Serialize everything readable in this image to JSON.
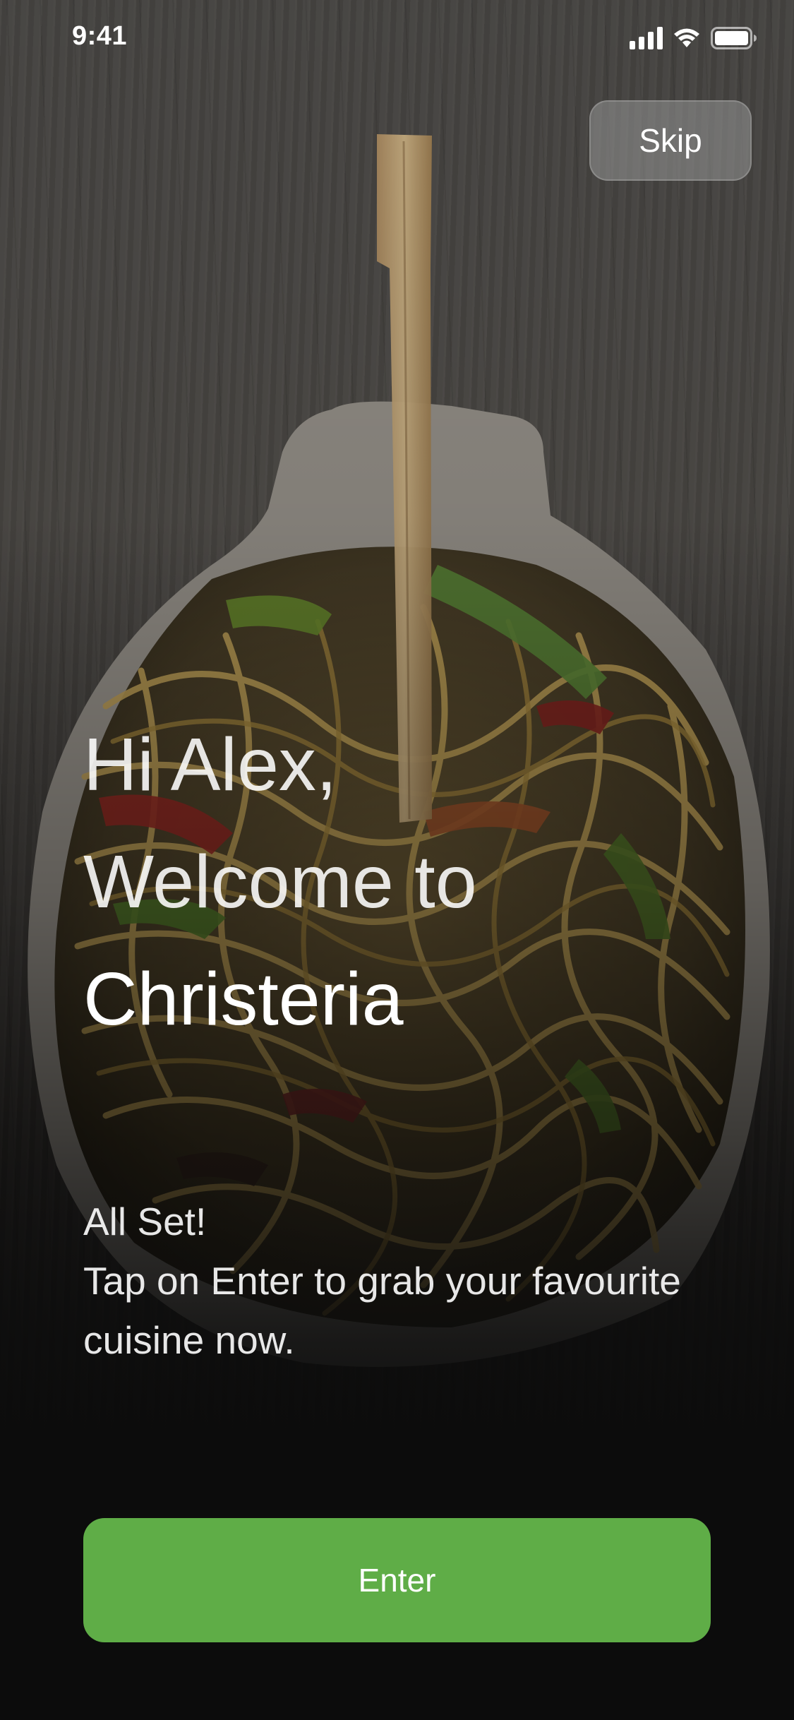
{
  "status_bar": {
    "time": "9:41",
    "icons": [
      "signal-icon",
      "wifi-icon",
      "battery-icon"
    ]
  },
  "header": {
    "skip_label": "Skip"
  },
  "welcome": {
    "greeting": "Hi Alex,",
    "line2": "Welcome to",
    "brand": "Christeria"
  },
  "subtitle": {
    "line1": "All Set!",
    "line2": "Tap on Enter to grab your favourite",
    "line3": "cuisine now."
  },
  "actions": {
    "enter_label": "Enter"
  },
  "colors": {
    "accent": "#5fad47",
    "background": "#0c0c0c",
    "skip_button": "#8a8a8a"
  }
}
